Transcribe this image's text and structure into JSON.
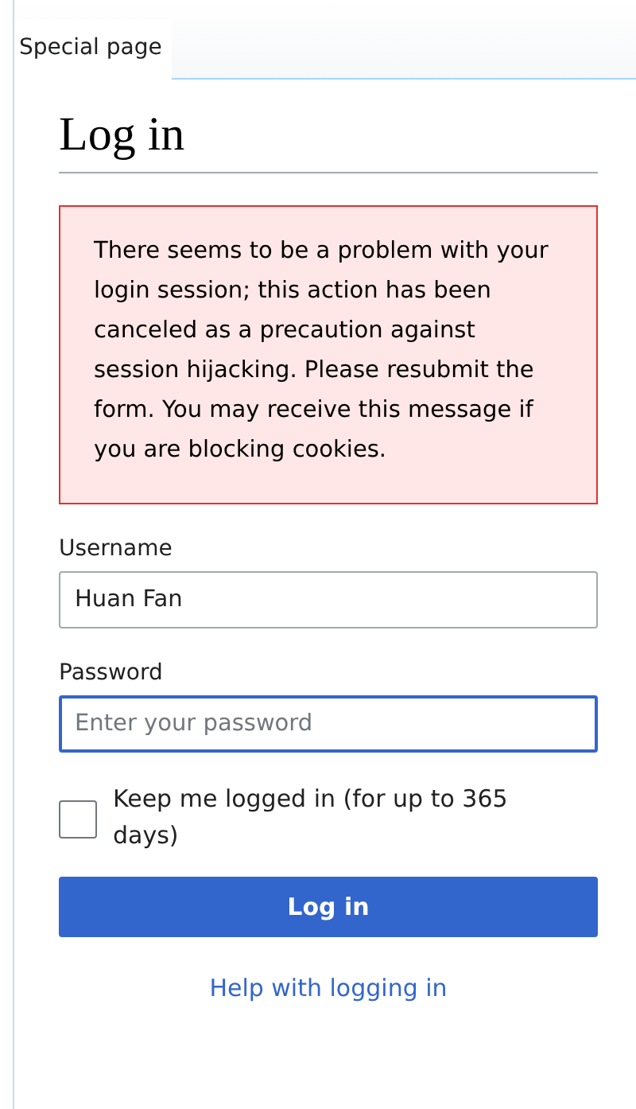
{
  "tabs": [
    {
      "label": "Special page",
      "selected": true
    }
  ],
  "heading": "Log in",
  "error_message": "There seems to be a problem with your login session; this action has been canceled as a precaution against session hijacking. Please resubmit the form. You may receive this message if you are blocking cookies.",
  "fields": [
    {
      "label": "Username",
      "value": "Huan Fan",
      "focused": false
    },
    {
      "label": "Password",
      "placeholder": "Enter your password",
      "focused": true
    }
  ],
  "remember": {
    "label": "Keep me logged in (for up to 365 days)",
    "checked": false
  },
  "submit_button": "Log in",
  "help_link": "Help with logging in"
}
